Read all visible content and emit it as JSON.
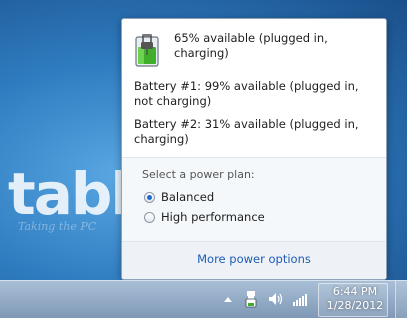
{
  "desktop": {
    "wallpaper_text": "tabl",
    "wallpaper_subtext": "Taking the PC"
  },
  "flyout": {
    "status": "65% available (plugged in, charging)",
    "battery1": "Battery #1: 99% available (plugged in, not charging)",
    "battery2": "Battery #2: 31% available (plugged in, charging)",
    "plan_title": "Select a power plan:",
    "plans": [
      {
        "label": "Balanced",
        "selected": true
      },
      {
        "label": "High performance",
        "selected": false
      }
    ],
    "more_link": "More power options"
  },
  "taskbar": {
    "time": "6:44 PM",
    "date": "1/28/2012",
    "icons": [
      "show-hidden-icons-arrow",
      "power-plug-icon",
      "speaker-icon",
      "network-signal-icon"
    ]
  },
  "colors": {
    "link": "#1e5cb3",
    "battery_green": "#3fae2a",
    "radio_selected": "#1d6ad6"
  }
}
